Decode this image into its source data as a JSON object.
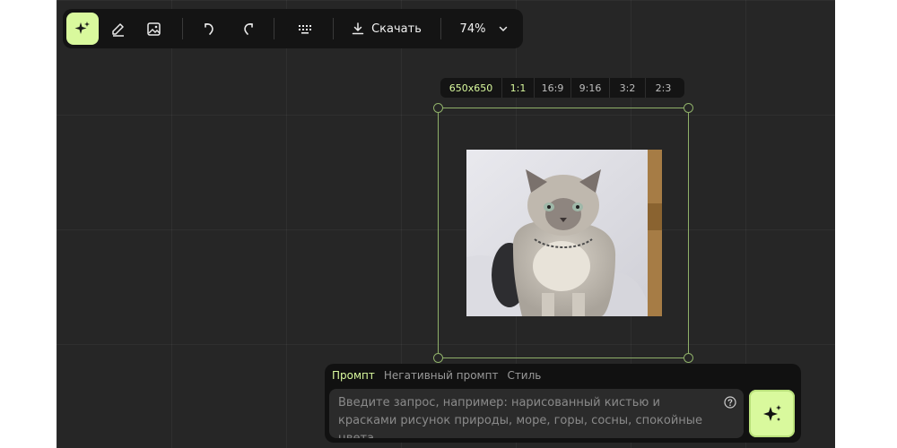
{
  "toolbar": {
    "magic_icon": "sparkle-icon",
    "edit_icon": "eraser-pen-icon",
    "image_icon": "add-image-icon",
    "undo_icon": "undo-icon",
    "redo_icon": "redo-icon",
    "keyboard_icon": "keyboard-icon",
    "download_icon": "download-icon",
    "download_label": "Скачать",
    "zoom": "74%",
    "zoom_icon": "chevron-down-icon"
  },
  "ratio_bar": {
    "size": "650x650",
    "options": [
      "1:1",
      "16:9",
      "9:16",
      "3:2",
      "2:3"
    ],
    "active": "1:1"
  },
  "prompt_panel": {
    "tabs": [
      "Промпт",
      "Негативный промпт",
      "Стиль"
    ],
    "active_tab": "Промпт",
    "input_value": "",
    "placeholder": "Введите запрос, например: нарисованный кистью и красками рисунок природы, море, горы, сосны, спокойные цвета",
    "help_icon": "question-circle-icon",
    "generate_icon": "sparkle-icon"
  },
  "canvas": {
    "image": "cat-photo"
  },
  "colors": {
    "accent": "#d9f99d",
    "frame": "#8fb069",
    "background": "#262626",
    "panel": "#141414"
  }
}
